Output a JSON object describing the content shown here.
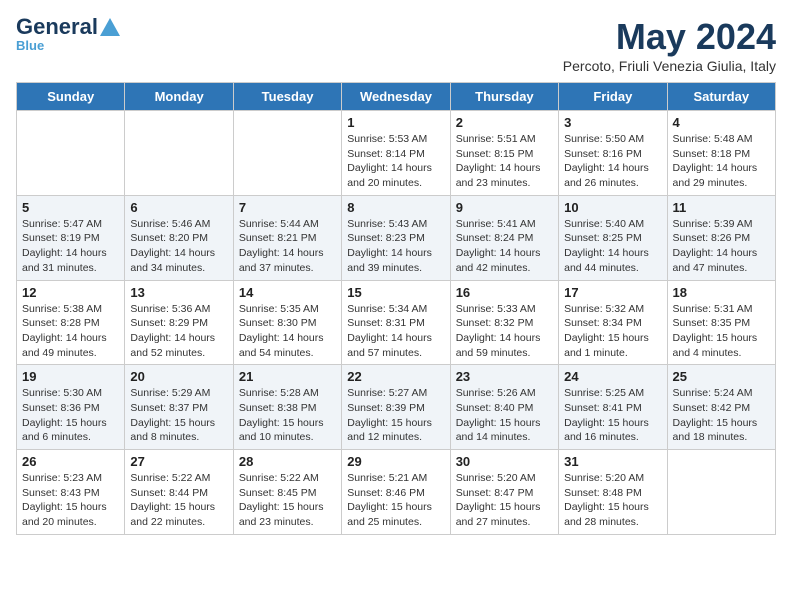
{
  "header": {
    "logo_general": "General",
    "logo_blue": "Blue",
    "month_title": "May 2024",
    "subtitle": "Percoto, Friuli Venezia Giulia, Italy"
  },
  "days_of_week": [
    "Sunday",
    "Monday",
    "Tuesday",
    "Wednesday",
    "Thursday",
    "Friday",
    "Saturday"
  ],
  "weeks": [
    [
      {
        "day": "",
        "info": ""
      },
      {
        "day": "",
        "info": ""
      },
      {
        "day": "",
        "info": ""
      },
      {
        "day": "1",
        "info": "Sunrise: 5:53 AM\nSunset: 8:14 PM\nDaylight: 14 hours\nand 20 minutes."
      },
      {
        "day": "2",
        "info": "Sunrise: 5:51 AM\nSunset: 8:15 PM\nDaylight: 14 hours\nand 23 minutes."
      },
      {
        "day": "3",
        "info": "Sunrise: 5:50 AM\nSunset: 8:16 PM\nDaylight: 14 hours\nand 26 minutes."
      },
      {
        "day": "4",
        "info": "Sunrise: 5:48 AM\nSunset: 8:18 PM\nDaylight: 14 hours\nand 29 minutes."
      }
    ],
    [
      {
        "day": "5",
        "info": "Sunrise: 5:47 AM\nSunset: 8:19 PM\nDaylight: 14 hours\nand 31 minutes."
      },
      {
        "day": "6",
        "info": "Sunrise: 5:46 AM\nSunset: 8:20 PM\nDaylight: 14 hours\nand 34 minutes."
      },
      {
        "day": "7",
        "info": "Sunrise: 5:44 AM\nSunset: 8:21 PM\nDaylight: 14 hours\nand 37 minutes."
      },
      {
        "day": "8",
        "info": "Sunrise: 5:43 AM\nSunset: 8:23 PM\nDaylight: 14 hours\nand 39 minutes."
      },
      {
        "day": "9",
        "info": "Sunrise: 5:41 AM\nSunset: 8:24 PM\nDaylight: 14 hours\nand 42 minutes."
      },
      {
        "day": "10",
        "info": "Sunrise: 5:40 AM\nSunset: 8:25 PM\nDaylight: 14 hours\nand 44 minutes."
      },
      {
        "day": "11",
        "info": "Sunrise: 5:39 AM\nSunset: 8:26 PM\nDaylight: 14 hours\nand 47 minutes."
      }
    ],
    [
      {
        "day": "12",
        "info": "Sunrise: 5:38 AM\nSunset: 8:28 PM\nDaylight: 14 hours\nand 49 minutes."
      },
      {
        "day": "13",
        "info": "Sunrise: 5:36 AM\nSunset: 8:29 PM\nDaylight: 14 hours\nand 52 minutes."
      },
      {
        "day": "14",
        "info": "Sunrise: 5:35 AM\nSunset: 8:30 PM\nDaylight: 14 hours\nand 54 minutes."
      },
      {
        "day": "15",
        "info": "Sunrise: 5:34 AM\nSunset: 8:31 PM\nDaylight: 14 hours\nand 57 minutes."
      },
      {
        "day": "16",
        "info": "Sunrise: 5:33 AM\nSunset: 8:32 PM\nDaylight: 14 hours\nand 59 minutes."
      },
      {
        "day": "17",
        "info": "Sunrise: 5:32 AM\nSunset: 8:34 PM\nDaylight: 15 hours\nand 1 minute."
      },
      {
        "day": "18",
        "info": "Sunrise: 5:31 AM\nSunset: 8:35 PM\nDaylight: 15 hours\nand 4 minutes."
      }
    ],
    [
      {
        "day": "19",
        "info": "Sunrise: 5:30 AM\nSunset: 8:36 PM\nDaylight: 15 hours\nand 6 minutes."
      },
      {
        "day": "20",
        "info": "Sunrise: 5:29 AM\nSunset: 8:37 PM\nDaylight: 15 hours\nand 8 minutes."
      },
      {
        "day": "21",
        "info": "Sunrise: 5:28 AM\nSunset: 8:38 PM\nDaylight: 15 hours\nand 10 minutes."
      },
      {
        "day": "22",
        "info": "Sunrise: 5:27 AM\nSunset: 8:39 PM\nDaylight: 15 hours\nand 12 minutes."
      },
      {
        "day": "23",
        "info": "Sunrise: 5:26 AM\nSunset: 8:40 PM\nDaylight: 15 hours\nand 14 minutes."
      },
      {
        "day": "24",
        "info": "Sunrise: 5:25 AM\nSunset: 8:41 PM\nDaylight: 15 hours\nand 16 minutes."
      },
      {
        "day": "25",
        "info": "Sunrise: 5:24 AM\nSunset: 8:42 PM\nDaylight: 15 hours\nand 18 minutes."
      }
    ],
    [
      {
        "day": "26",
        "info": "Sunrise: 5:23 AM\nSunset: 8:43 PM\nDaylight: 15 hours\nand 20 minutes."
      },
      {
        "day": "27",
        "info": "Sunrise: 5:22 AM\nSunset: 8:44 PM\nDaylight: 15 hours\nand 22 minutes."
      },
      {
        "day": "28",
        "info": "Sunrise: 5:22 AM\nSunset: 8:45 PM\nDaylight: 15 hours\nand 23 minutes."
      },
      {
        "day": "29",
        "info": "Sunrise: 5:21 AM\nSunset: 8:46 PM\nDaylight: 15 hours\nand 25 minutes."
      },
      {
        "day": "30",
        "info": "Sunrise: 5:20 AM\nSunset: 8:47 PM\nDaylight: 15 hours\nand 27 minutes."
      },
      {
        "day": "31",
        "info": "Sunrise: 5:20 AM\nSunset: 8:48 PM\nDaylight: 15 hours\nand 28 minutes."
      },
      {
        "day": "",
        "info": ""
      }
    ]
  ]
}
